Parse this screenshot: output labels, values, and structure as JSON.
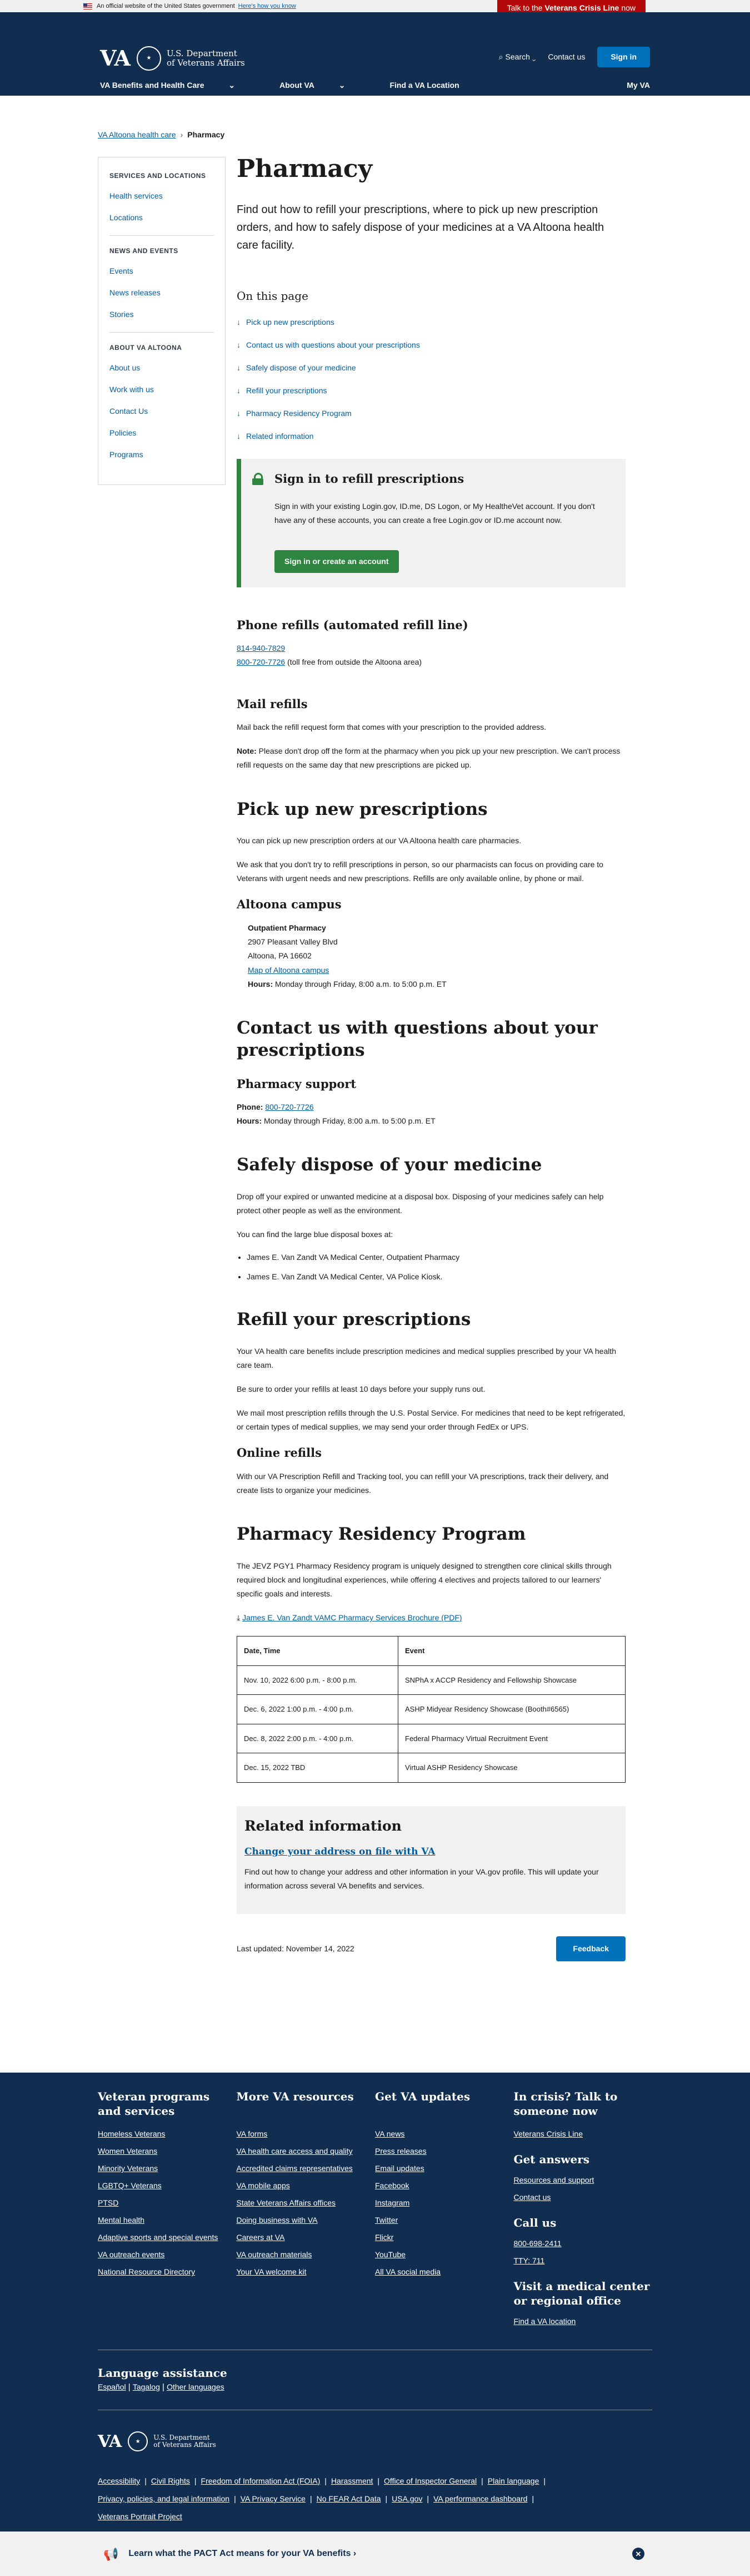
{
  "banner": {
    "text": "An official website of the United States government",
    "link": "Here's how you know"
  },
  "crisis_top": {
    "pre": "Talk to the",
    "bold": "Veterans Crisis Line",
    "post": "now"
  },
  "header": {
    "va": "VA",
    "dept_line1": "U.S. Department",
    "dept_line2": "of Veterans Affairs",
    "search": "Search",
    "contact": "Contact us",
    "signin": "Sign in",
    "nav": [
      "VA Benefits and Health Care",
      "About VA",
      "Find a VA Location"
    ],
    "myva": "My VA"
  },
  "breadcrumb": {
    "parent": "VA Altoona health care",
    "current": "Pharmacy"
  },
  "sidenav": {
    "groups": [
      {
        "title": "SERVICES AND LOCATIONS",
        "items": [
          "Health services",
          "Locations"
        ]
      },
      {
        "title": "NEWS AND EVENTS",
        "items": [
          "Events",
          "News releases",
          "Stories"
        ]
      },
      {
        "title": "ABOUT VA ALTOONA",
        "items": [
          "About us",
          "Work with us",
          "Contact Us",
          "Policies",
          "Programs"
        ]
      }
    ]
  },
  "page": {
    "title": "Pharmacy",
    "intro": "Find out how to refill your prescriptions, where to pick up new prescription orders, and how to safely dispose of your medicines at a VA Altoona health care facility.",
    "otp_title": "On this page",
    "otp": [
      "Pick up new prescriptions",
      "Contact us with questions about your prescriptions",
      "Safely dispose of your medicine",
      "Refill your prescriptions",
      "Pharmacy Residency Program",
      "Related information"
    ]
  },
  "alert": {
    "title": "Sign in to refill prescriptions",
    "text": "Sign in with your existing Login.gov, ID.me, DS Logon, or My HealtheVet account. If you don't have any of these accounts, you can create a free Login.gov or ID.me account now.",
    "button": "Sign in or create an account"
  },
  "phone_refills": {
    "title": "Phone refills (automated refill line)",
    "phone1": "814-940-7829",
    "phone2": "800-720-7726",
    "phone2_note": "(toll free from outside the Altoona area)"
  },
  "mail_refills": {
    "title": "Mail refills",
    "text": "Mail back the refill request form that comes with your prescription to the provided address.",
    "note_label": "Note:",
    "note": "Please don't drop off the form at the pharmacy when you pick up your new prescription. We can't process refill requests on the same day that new prescriptions are picked up."
  },
  "pickup": {
    "title": "Pick up new prescriptions",
    "p1": "You can pick up new prescription orders at our VA Altoona health care pharmacies.",
    "p2": "We ask that you don't try to refill prescriptions in person, so our pharmacists can focus on providing care to Veterans with urgent needs and new prescriptions. Refills are only available online, by phone or mail.",
    "campus": "Altoona campus",
    "loc_name": "Outpatient Pharmacy",
    "addr1": "2907 Pleasant Valley Blvd",
    "addr2": "Altoona, PA 16602",
    "map": "Map of Altoona campus",
    "hours_label": "Hours:",
    "hours": "Monday through Friday, 8:00 a.m. to 5:00 p.m. ET"
  },
  "contact": {
    "title": "Contact us with questions about your prescriptions",
    "sub": "Pharmacy support",
    "phone_label": "Phone:",
    "phone": "800-720-7726",
    "hours_label": "Hours:",
    "hours": "Monday through Friday, 8:00 a.m. to 5:00 p.m. ET"
  },
  "dispose": {
    "title": "Safely dispose of your medicine",
    "p1": "Drop off your expired or unwanted medicine at a disposal box. Disposing of your medicines safely can help protect other people as well as the environment.",
    "p2": "You can find the large blue disposal boxes at:",
    "items": [
      "James E. Van Zandt VA Medical Center, Outpatient Pharmacy",
      "James E. Van Zandt VA Medical Center, VA Police Kiosk."
    ]
  },
  "refill": {
    "title": "Refill your prescriptions",
    "p1": "Your VA health care benefits include prescription medicines and medical supplies prescribed by your VA health care team.",
    "p2": "Be sure to order your refills at least 10 days before your supply runs out.",
    "p3": "We mail most prescription refills through the U.S. Postal Service. For medicines that need to be kept refrigerated, or certain types of medical supplies, we may send your order through FedEx or UPS.",
    "online_title": "Online refills",
    "online": "With our VA Prescription Refill and Tracking tool, you can refill your VA prescriptions, track their delivery, and create lists to organize your medicines."
  },
  "residency": {
    "title": "Pharmacy Residency Program",
    "p1": "The JEVZ PGY1 Pharmacy Residency program is uniquely designed to strengthen core clinical skills through required block and longitudinal experiences, while offering 4 electives and projects tailored to our learners' specific goals and interests.",
    "brochure": "James E. Van Zandt VAMC Pharmacy Services Brochure (PDF)",
    "table_headers": [
      "Date, Time",
      "Event"
    ],
    "rows": [
      [
        "Nov. 10, 2022 6:00 p.m. - 8:00 p.m.",
        "SNPhA x ACCP Residency and Fellowship Showcase"
      ],
      [
        "Dec. 6, 2022 1:00 p.m. - 4:00 p.m.",
        "ASHP Midyear Residency Showcase (Booth#6565)"
      ],
      [
        "Dec. 8, 2022 2:00 p.m. - 4:00 p.m.",
        "Federal Pharmacy Virtual Recruitment Event"
      ],
      [
        "Dec. 15, 2022 TBD",
        "Virtual ASHP Residency Showcase"
      ]
    ]
  },
  "related": {
    "title": "Related information",
    "link": "Change your address on file with VA",
    "text": "Find out how to change your address and other information in your VA.gov profile. This will update your information across several VA benefits and services."
  },
  "lastup": "Last updated: November 14, 2022",
  "feedback": "Feedback",
  "footer": {
    "col1": {
      "title": "Veteran programs and services",
      "items": [
        "Homeless Veterans",
        "Women Veterans",
        "Minority Veterans",
        "LGBTQ+ Veterans",
        "PTSD",
        "Mental health",
        "Adaptive sports and special events",
        "VA outreach events",
        "National Resource Directory"
      ]
    },
    "col2": {
      "title": "More VA resources",
      "items": [
        "VA forms",
        "VA health care access and quality",
        "Accredited claims representatives",
        "VA mobile apps",
        "State Veterans Affairs offices",
        "Doing business with VA",
        "Careers at VA",
        "VA outreach materials",
        "Your VA welcome kit"
      ]
    },
    "col3": {
      "title": "Get VA updates",
      "items": [
        "VA news",
        "Press releases",
        "Email updates",
        "Facebook",
        "Instagram",
        "Twitter",
        "Flickr",
        "YouTube",
        "All VA social media"
      ]
    },
    "col4": {
      "title": "In crisis? Talk to someone now",
      "crisis": "Veterans Crisis Line",
      "answers_title": "Get answers",
      "answers": [
        "Resources and support",
        "Contact us"
      ],
      "call_title": "Call us",
      "call": [
        "800-698-2411",
        "TTY: 711"
      ],
      "visit_title": "Visit a medical center or regional office",
      "visit": "Find a VA location"
    },
    "lang_title": "Language assistance",
    "langs": [
      "Español",
      "Tagalog",
      "Other languages"
    ],
    "links": [
      "Accessibility",
      "Civil Rights",
      "Freedom of Information Act (FOIA)",
      "Harassment",
      "Office of Inspector General",
      "Plain language",
      "Privacy, policies, and legal information",
      "VA Privacy Service",
      "No FEAR Act Data",
      "USA.gov",
      "VA performance dashboard",
      "Veterans Portrait Project"
    ],
    "pact": "Learn what the PACT Act means for your VA benefits ›"
  }
}
